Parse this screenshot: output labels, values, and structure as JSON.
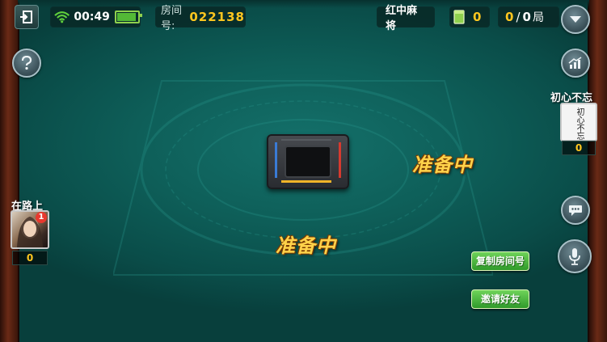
{
  "status": {
    "time": "00:49",
    "battery_level": 0.85
  },
  "room": {
    "label": "房间号:",
    "number": "022138"
  },
  "game": {
    "name": "红中麻将",
    "cards_left": "0",
    "round_current": "0",
    "round_sep": "/",
    "round_total": "0",
    "round_unit": "局"
  },
  "players": {
    "left": {
      "name": "在路上",
      "score": "0",
      "badge": "1"
    },
    "right": {
      "name": "初心不忘",
      "avatar_text": "初心不忘",
      "score": "0"
    }
  },
  "status_text": {
    "bottom": "准备中",
    "right": "准备中"
  },
  "buttons": {
    "copy_room": "复制房间号",
    "invite": "邀请好友"
  },
  "colors": {
    "felt": "#0e5f59",
    "accent_gold": "#ffc61f",
    "button_green": "#3fb236"
  },
  "icons": {
    "exit": "exit-door-icon",
    "wifi": "wifi-icon",
    "battery": "battery-icon",
    "card": "card-stack-icon",
    "menu": "chevron-down-icon",
    "help": "question-icon",
    "stats": "chart-trend-icon",
    "chat": "chat-bubble-icon",
    "mic": "microphone-icon"
  }
}
